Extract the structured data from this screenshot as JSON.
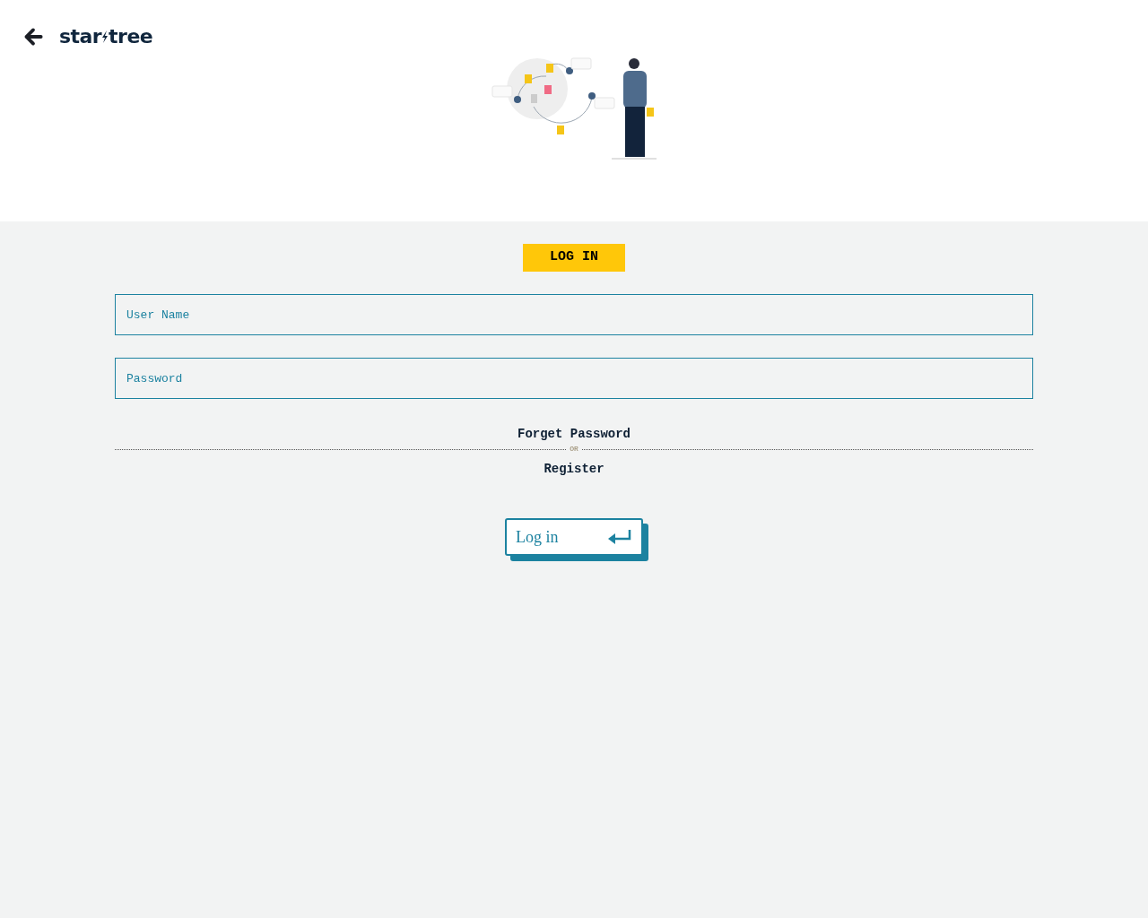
{
  "header": {
    "logo": [
      "star",
      "tree"
    ]
  },
  "form": {
    "title": "LOG IN",
    "fields": [
      {
        "placeholder": "User Name"
      },
      {
        "placeholder": "Password"
      }
    ],
    "forgot_link": "Forget Password",
    "divider": "OR",
    "register_link": "Register",
    "submit": "Log in"
  }
}
